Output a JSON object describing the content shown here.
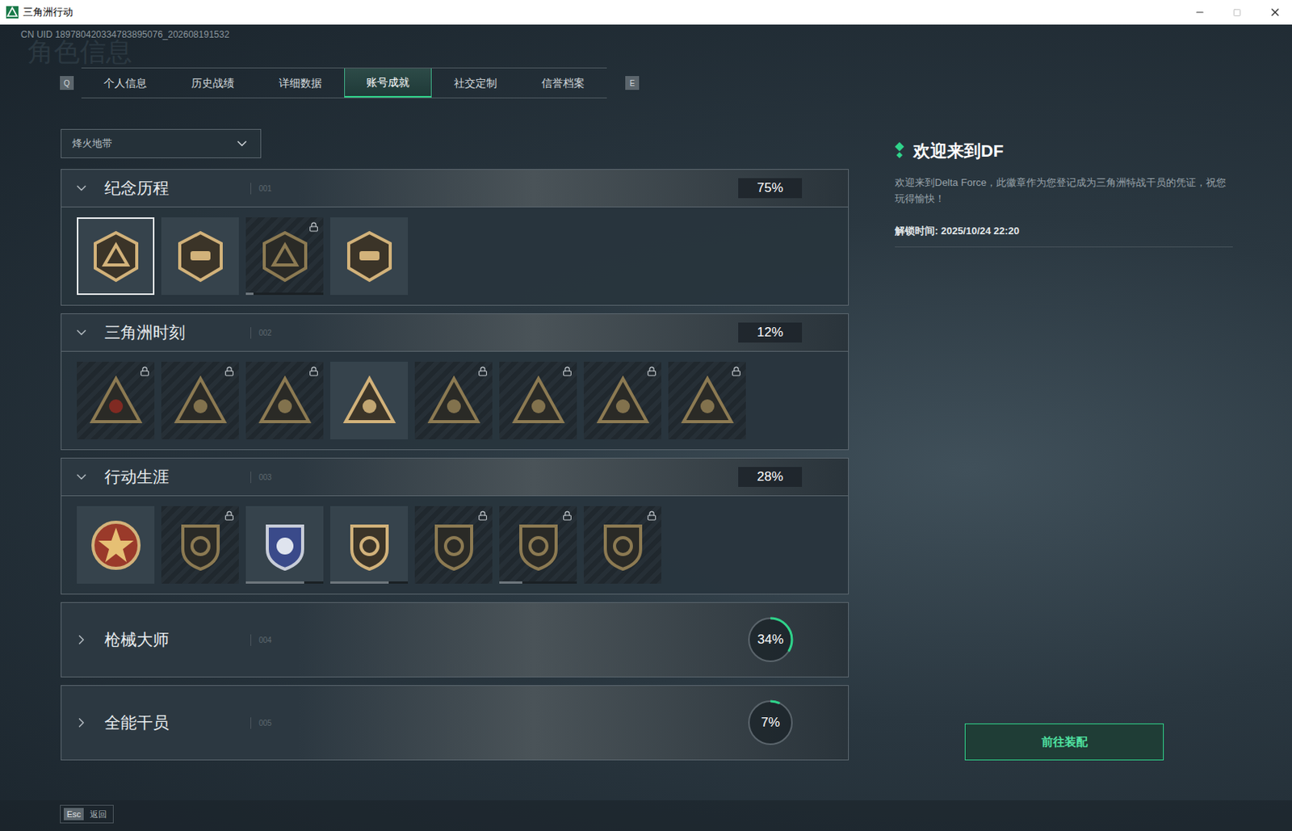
{
  "window": {
    "title": "三角洲行动"
  },
  "uid": "CN UID 189780420334783895076_202608191532",
  "watermark": "角色信息",
  "tabs": {
    "prev_key": "Q",
    "next_key": "E",
    "items": [
      {
        "label": "个人信息",
        "selected": false
      },
      {
        "label": "历史战绩",
        "selected": false
      },
      {
        "label": "详细数据",
        "selected": false
      },
      {
        "label": "账号成就",
        "selected": true
      },
      {
        "label": "社交定制",
        "selected": false
      },
      {
        "label": "信誉档案",
        "selected": false
      }
    ]
  },
  "mode_select": {
    "value": "烽火地带"
  },
  "sections": [
    {
      "title": "纪念历程",
      "code": "001",
      "percent": "75%",
      "level": 0.75,
      "expanded": true,
      "badges": [
        {
          "locked": false,
          "selected": true
        },
        {
          "locked": false,
          "selected": false
        },
        {
          "locked": true,
          "selected": false,
          "level": 0.1
        },
        {
          "locked": false,
          "selected": false
        }
      ]
    },
    {
      "title": "三角洲时刻",
      "code": "002",
      "percent": "12%",
      "level": 0.12,
      "expanded": true,
      "badges": [
        {
          "locked": true,
          "selected": false
        },
        {
          "locked": true,
          "selected": false
        },
        {
          "locked": true,
          "selected": false
        },
        {
          "locked": false,
          "selected": false
        },
        {
          "locked": true,
          "selected": false
        },
        {
          "locked": true,
          "selected": false
        },
        {
          "locked": true,
          "selected": false
        },
        {
          "locked": true,
          "selected": false
        }
      ]
    },
    {
      "title": "行动生涯",
      "code": "003",
      "percent": "28%",
      "level": 0.28,
      "expanded": true,
      "badges": [
        {
          "locked": false,
          "selected": false
        },
        {
          "locked": true,
          "selected": false
        },
        {
          "locked": false,
          "selected": false,
          "level": 0.75
        },
        {
          "locked": false,
          "selected": false,
          "level": 0.75
        },
        {
          "locked": true,
          "selected": false
        },
        {
          "locked": true,
          "selected": false,
          "level": 0.3
        },
        {
          "locked": true,
          "selected": false
        }
      ]
    },
    {
      "title": "枪械大师",
      "code": "004",
      "percent": "34%",
      "level": 0.34,
      "expanded": false,
      "badges": []
    },
    {
      "title": "全能干员",
      "code": "005",
      "percent": "7%",
      "level": 0.07,
      "expanded": false,
      "badges": []
    }
  ],
  "detail": {
    "title": "欢迎来到DF",
    "description": "欢迎来到Delta Force，此徽章作为您登记成为三角洲特战干员的凭证，祝您玩得愉快！",
    "unlock_time": "解锁时间: 2025/10/24 22:20"
  },
  "equip_button": "前往装配",
  "footer": {
    "key": "Esc",
    "label": "返回"
  }
}
